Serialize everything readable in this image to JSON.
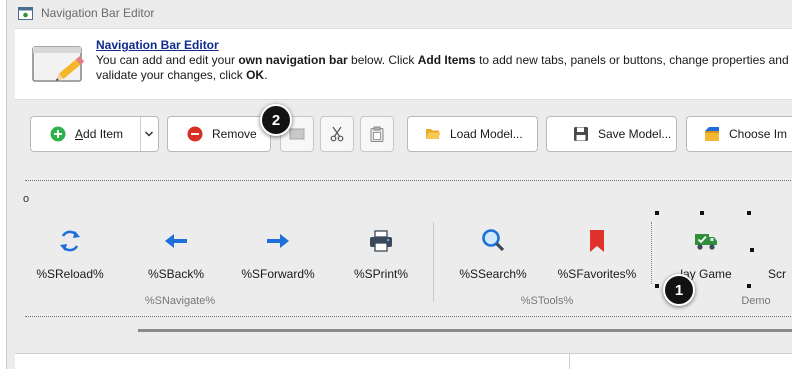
{
  "window": {
    "title": "Navigation Bar Editor",
    "icon": "navbar-editor-icon"
  },
  "header": {
    "title": "Navigation Bar Editor",
    "desc_line1_a": "You can add and edit your ",
    "desc_line1_b": "own navigation bar",
    "desc_line1_c": " below. Click ",
    "desc_line1_d": "Add Items",
    "desc_line1_e": " to add new tabs, panels or buttons, change properties and s",
    "desc_line2_a": "validate your changes, click ",
    "desc_line2_b": "OK",
    "desc_line2_c": ".",
    "illustration": "edit-pencil-illustration"
  },
  "toolbar": {
    "add_label": "Add Item",
    "add_accel": "A",
    "remove_label": "Remove",
    "load_label": "Load Model...",
    "save_label": "Save Model...",
    "choose_label": "Choose Im"
  },
  "edge_label": "o",
  "nav": {
    "groups": [
      {
        "label": "%SNavigate%"
      },
      {
        "label": "%STools%"
      },
      {
        "label": "Demo"
      }
    ],
    "items": [
      {
        "label": "%SReload%",
        "icon": "reload-icon"
      },
      {
        "label": "%SBack%",
        "icon": "arrow-left-icon"
      },
      {
        "label": "%SForward%",
        "icon": "arrow-right-icon"
      },
      {
        "label": "%SPrint%",
        "icon": "printer-icon"
      },
      {
        "label": "%SSearch%",
        "icon": "search-icon"
      },
      {
        "label": "%SFavorites%",
        "icon": "bookmark-icon"
      },
      {
        "label": "lay Game",
        "icon": "delivery-truck-icon"
      },
      {
        "label": "Scr",
        "icon": ""
      }
    ]
  },
  "callouts": [
    "1",
    "2"
  ],
  "colors": {
    "accent_blue": "#1e6fd9",
    "add_green": "#2fb14a",
    "remove_red": "#d93025",
    "favorites_red": "#e0322d",
    "truck_green": "#2f8f3a",
    "link_blue": "#102a8c"
  }
}
